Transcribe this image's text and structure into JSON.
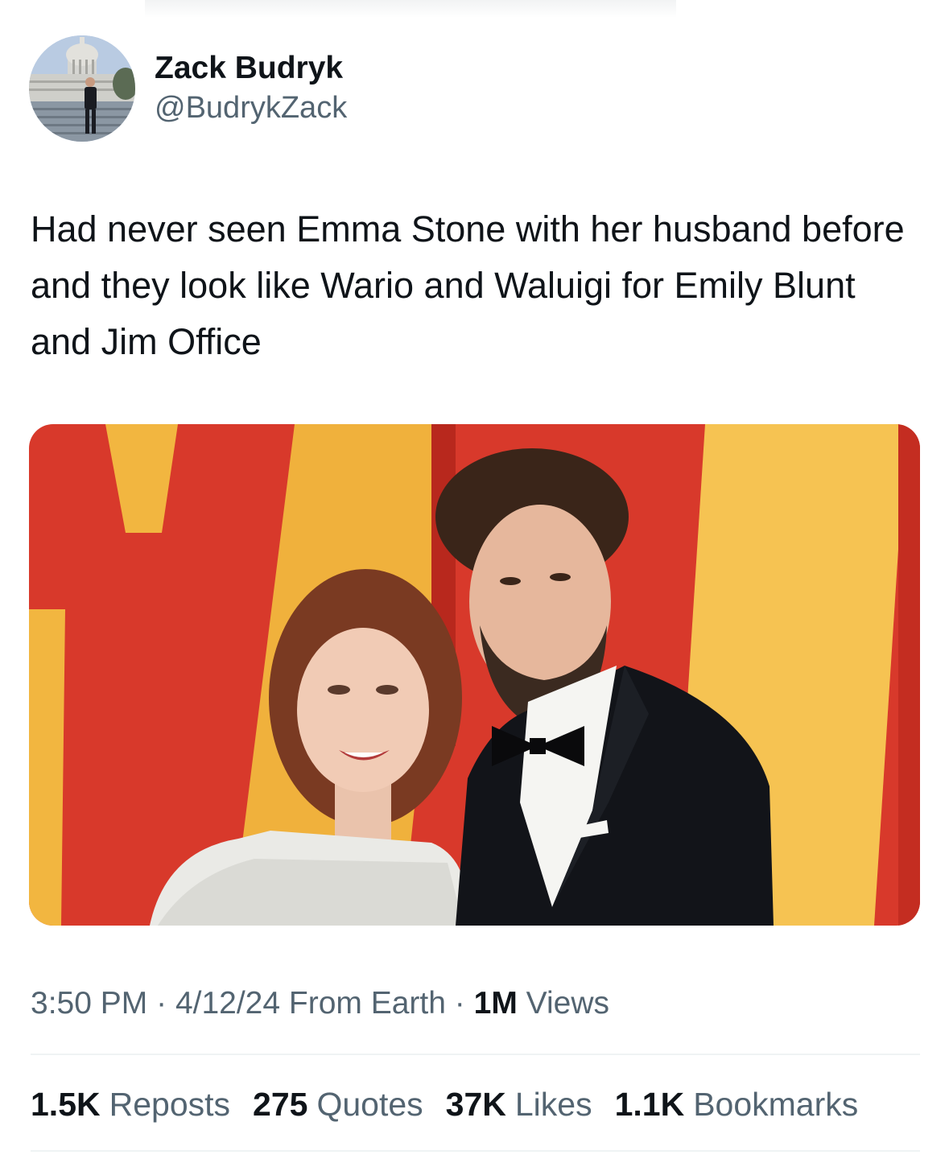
{
  "author": {
    "display_name": "Zack Budryk",
    "handle": "@BudrykZack",
    "avatar_icon": "profile-photo-capitol-steps"
  },
  "tweet": {
    "text": "Had never seen Emma Stone with her husband before and they look like Wario and Waluigi for Emily Blunt and Jim Office"
  },
  "media": {
    "type": "photo",
    "description_icon": "red-carpet-couple-photo"
  },
  "meta": {
    "time": "3:50 PM",
    "sep1": "·",
    "date": "4/12/24",
    "source": "From Earth",
    "sep2": "·",
    "views_count": "1M",
    "views_label": "Views"
  },
  "stats": {
    "reposts_count": "1.5K",
    "reposts_label": "Reposts",
    "quotes_count": "275",
    "quotes_label": "Quotes",
    "likes_count": "37K",
    "likes_label": "Likes",
    "bookmarks_count": "1.1K",
    "bookmarks_label": "Bookmarks"
  },
  "colors": {
    "text_primary": "#0f1419",
    "text_secondary": "#536471",
    "divider": "#eff3f4",
    "backdrop_red": "#d8392b",
    "backdrop_gold": "#f2b640"
  }
}
